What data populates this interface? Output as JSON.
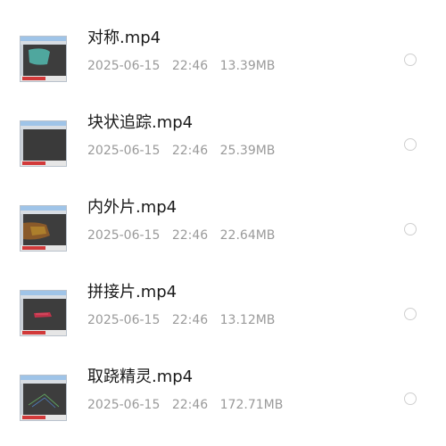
{
  "files": [
    {
      "name": "对称.mp4",
      "date": "2025-06-15",
      "time": "22:46",
      "size": "13.39MB",
      "thumbnail": "teal-shape-thumbnail"
    },
    {
      "name": "块状追踪.mp4",
      "date": "2025-06-15",
      "time": "22:46",
      "size": "25.39MB",
      "thumbnail": "blank-canvas-thumbnail"
    },
    {
      "name": "内外片.mp4",
      "date": "2025-06-15",
      "time": "22:46",
      "size": "22.64MB",
      "thumbnail": "orange-shape-thumbnail"
    },
    {
      "name": "拼接片.mp4",
      "date": "2025-06-15",
      "time": "22:46",
      "size": "13.12MB",
      "thumbnail": "red-shape-thumbnail"
    },
    {
      "name": "取跷精灵.mp4",
      "date": "2025-06-15",
      "time": "22:46",
      "size": "172.71MB",
      "thumbnail": "line-drawing-thumbnail"
    }
  ],
  "colors": {
    "name_text": "#1a1a1a",
    "meta_text": "#9a9a9a",
    "radio_border": "#cfcfcf",
    "thumb_bg": "#3d3d3d"
  }
}
